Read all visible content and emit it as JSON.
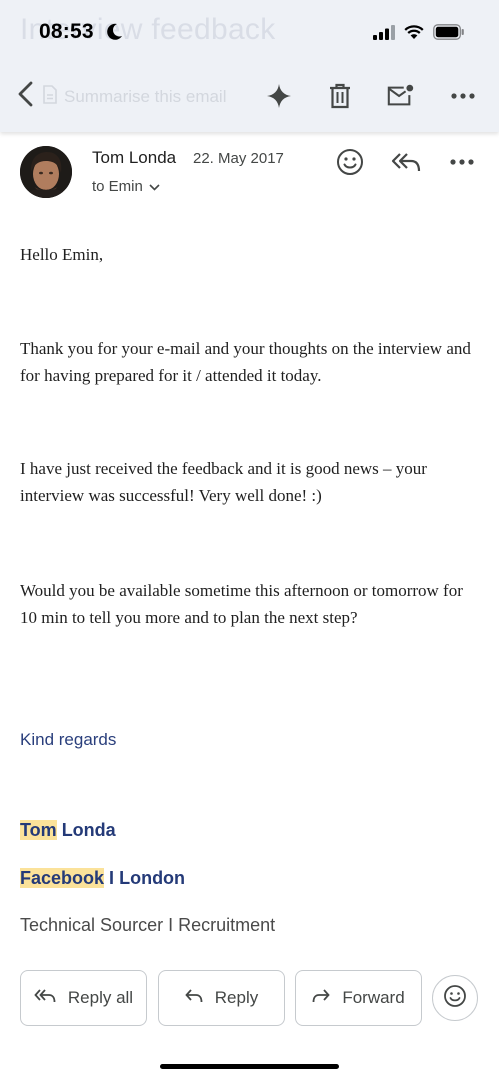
{
  "status_bar": {
    "time": "08:53",
    "icons": [
      "moon-icon",
      "cellular-signal-icon",
      "wifi-icon",
      "battery-icon"
    ]
  },
  "background_title": "Interview feedback",
  "toolbar": {
    "back_icon": "chevron-left-icon",
    "summarise_label": "Summarise this email",
    "icons": [
      "sparkle-icon",
      "trash-icon",
      "mark-unread-icon",
      "more-vert-icon"
    ]
  },
  "message": {
    "sender_name": "Tom Londa",
    "date": "22. May 2017",
    "recipient": "to Emin",
    "header_icons": [
      "emoji-react-icon",
      "reply-all-icon",
      "more-icon"
    ],
    "greeting": "Hello Emin,",
    "paragraphs": [
      "Thank you for your e-mail and your thoughts on the interview and for having prepared for it / attended it today.",
      "I have just received the feedback and it is good news – your interview was successful! Very well done! :)",
      "Would you be available sometime this afternoon or tomorrow for 10 min to tell you more and to plan the next step?"
    ],
    "sign_off": "Kind regards",
    "signature": {
      "first_name": "Tom",
      "last_name": "Londa",
      "company": "Facebook",
      "separator": "I",
      "city": "London",
      "role": "Technical Sourcer I Recruitment"
    }
  },
  "actions": {
    "reply_all": "Reply all",
    "reply": "Reply",
    "forward": "Forward"
  },
  "colors": {
    "toolbar_bg": "#eef1f6",
    "signature_blue": "#243a78",
    "highlight": "#fbe29a"
  }
}
